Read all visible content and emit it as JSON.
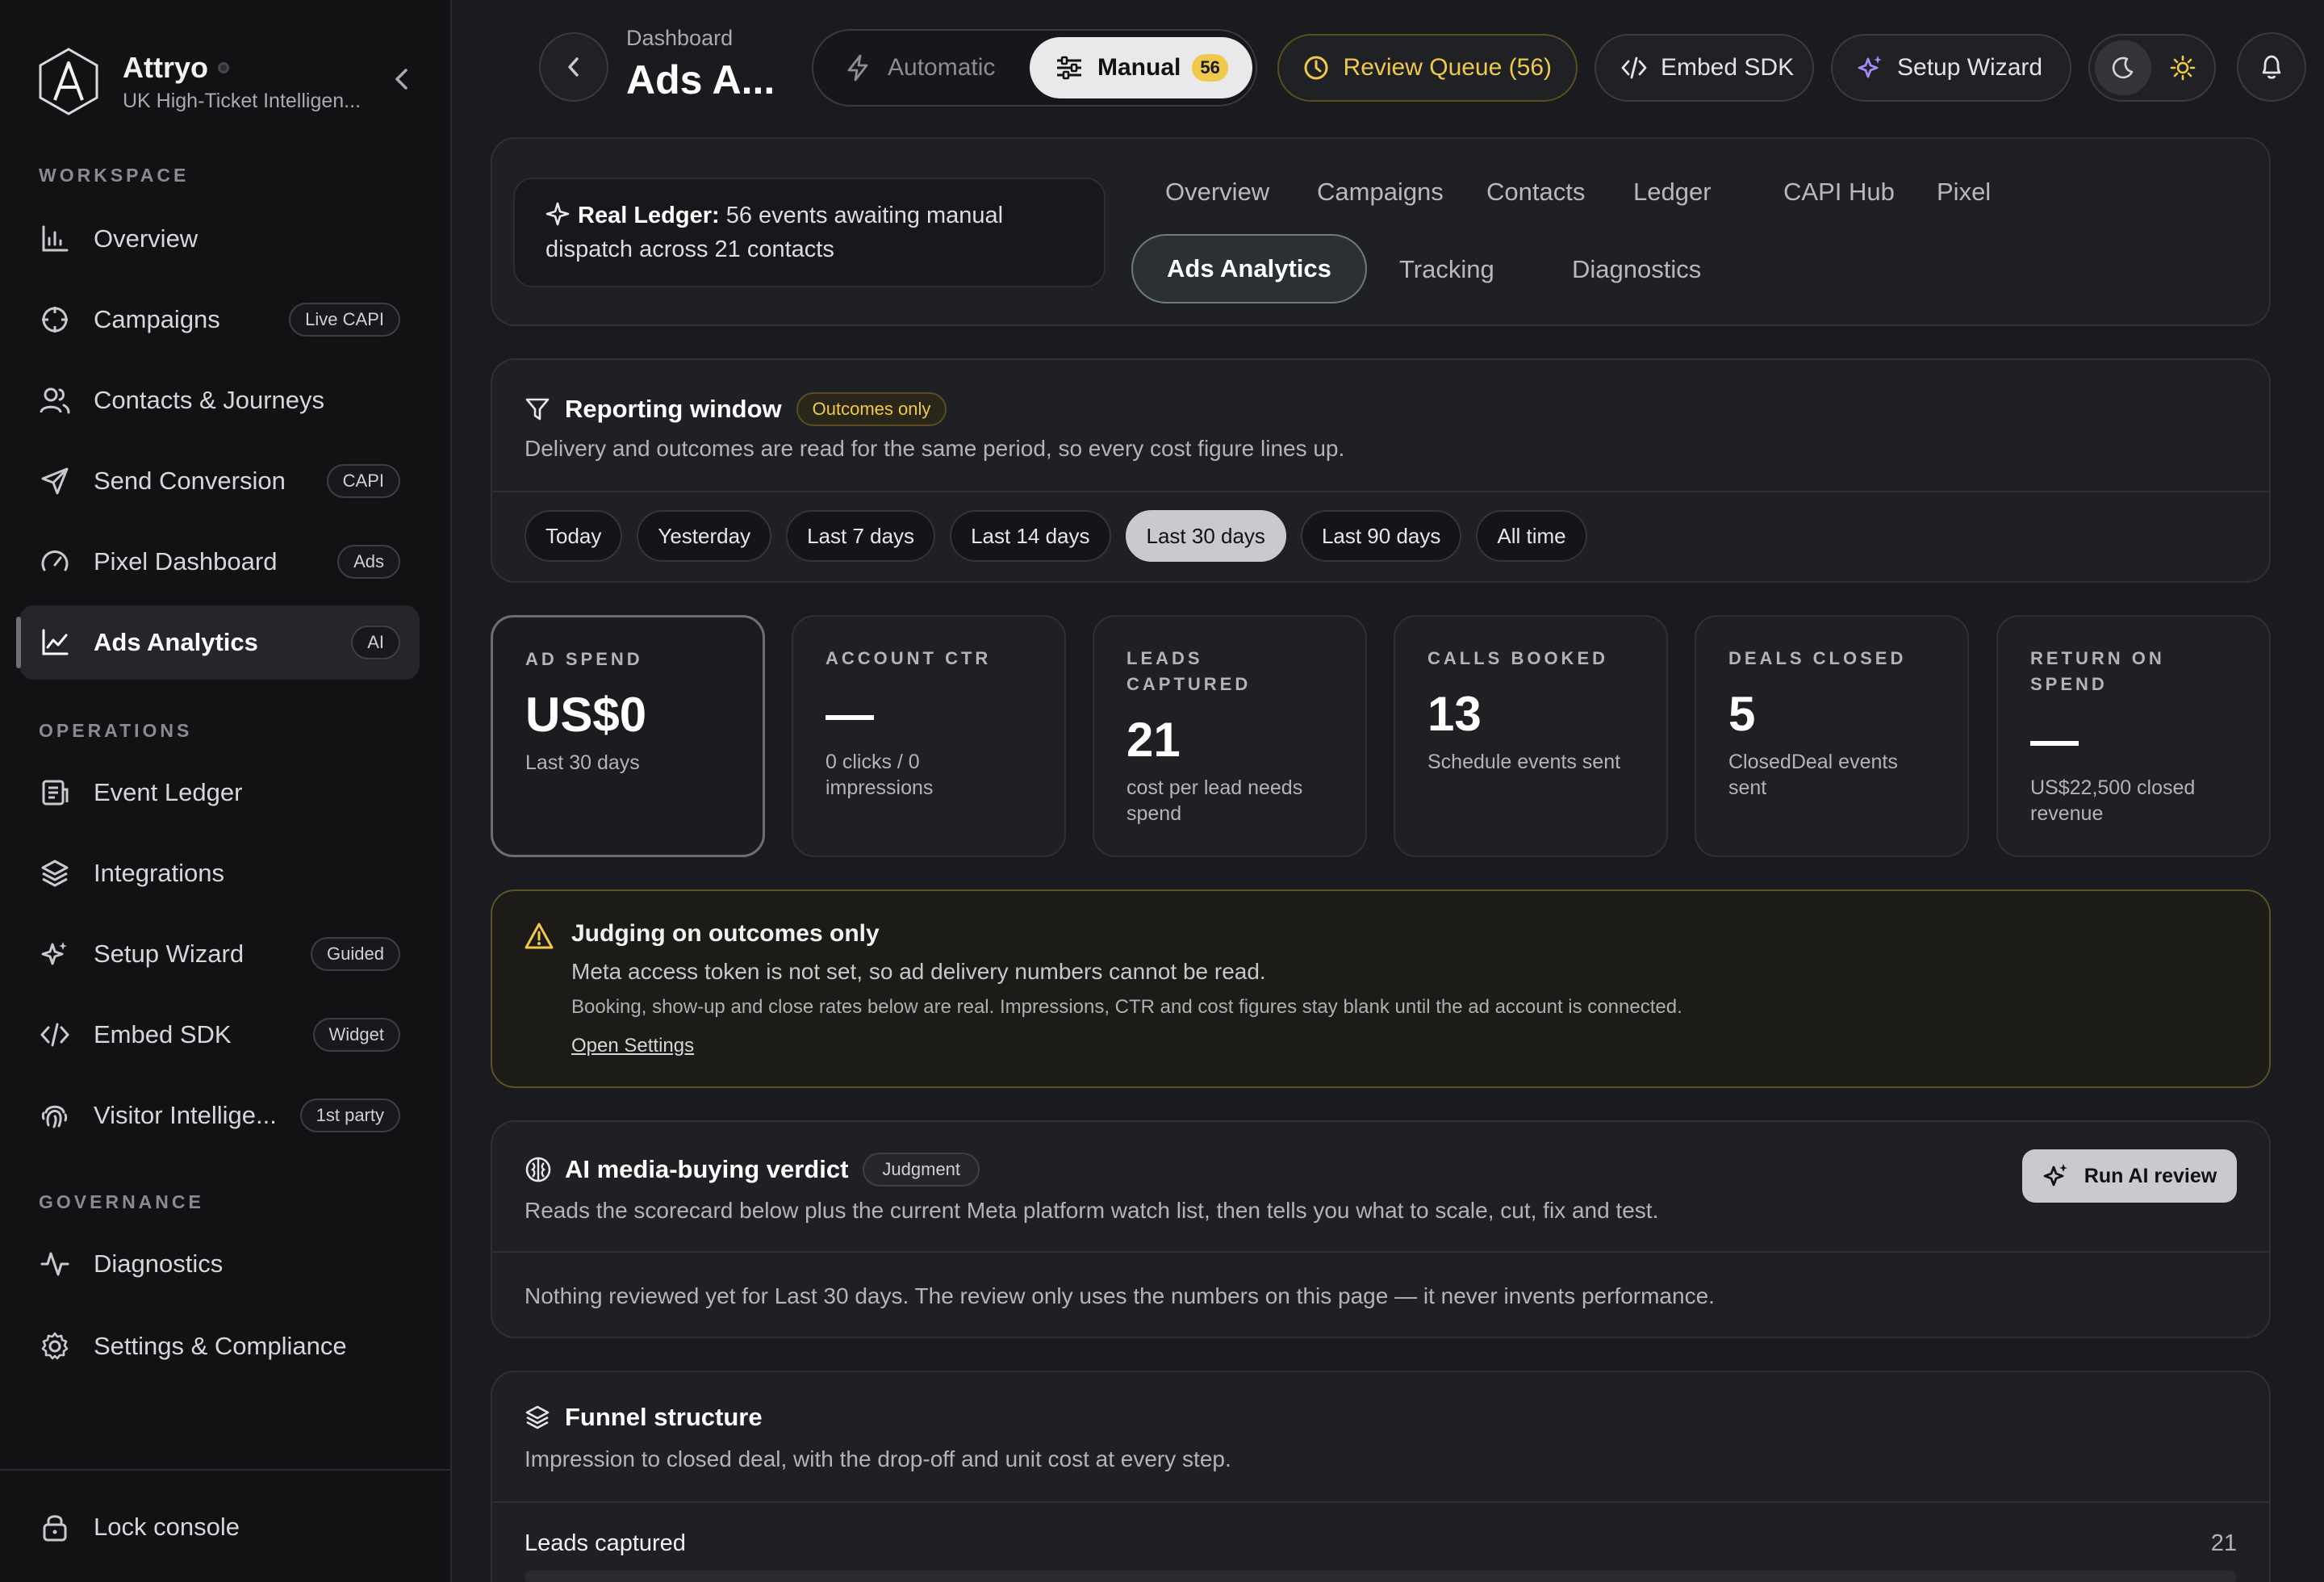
{
  "brand": {
    "name": "Attryo",
    "subtitle": "UK High-Ticket Intelligen..."
  },
  "sidebar": {
    "sections": {
      "workspace": "WORKSPACE",
      "operations": "OPERATIONS",
      "governance": "GOVERNANCE"
    },
    "items": [
      {
        "label": "Overview",
        "badge": ""
      },
      {
        "label": "Campaigns",
        "badge": "Live CAPI"
      },
      {
        "label": "Contacts & Journeys",
        "badge": ""
      },
      {
        "label": "Send Conversion",
        "badge": "CAPI"
      },
      {
        "label": "Pixel Dashboard",
        "badge": "Ads"
      },
      {
        "label": "Ads Analytics",
        "badge": "AI"
      },
      {
        "label": "Event Ledger",
        "badge": ""
      },
      {
        "label": "Integrations",
        "badge": ""
      },
      {
        "label": "Setup Wizard",
        "badge": "Guided"
      },
      {
        "label": "Embed SDK",
        "badge": "Widget"
      },
      {
        "label": "Visitor Intellige...",
        "badge": "1st party"
      },
      {
        "label": "Diagnostics",
        "badge": ""
      },
      {
        "label": "Settings & Compliance",
        "badge": ""
      }
    ],
    "footer": {
      "lock_label": "Lock console"
    }
  },
  "header": {
    "breadcrumb": "Dashboard",
    "title": "Ads A...",
    "mode": {
      "automatic": "Automatic",
      "manual": "Manual",
      "manual_count": "56"
    },
    "review_queue": "Review Queue (56)",
    "embed_sdk": "Embed SDK",
    "setup_wizard": "Setup Wizard"
  },
  "ledger": {
    "label": "Real Ledger:",
    "message": "56 events awaiting manual dispatch across 21 contacts"
  },
  "tabs": [
    "Overview",
    "Campaigns",
    "Contacts",
    "Ledger",
    "CAPI Hub",
    "Pixel",
    "Ads Analytics",
    "Tracking",
    "Diagnostics"
  ],
  "active_tab": "Ads Analytics",
  "reporting": {
    "title": "Reporting window",
    "tag": "Outcomes only",
    "subtitle": "Delivery and outcomes are read for the same period, so every cost figure lines up.",
    "ranges": [
      "Today",
      "Yesterday",
      "Last 7 days",
      "Last 14 days",
      "Last 30 days",
      "Last 90 days",
      "All time"
    ],
    "selected": "Last 30 days"
  },
  "kpis": [
    {
      "label": "AD SPEND",
      "value": "US$0",
      "sub": "Last 30 days"
    },
    {
      "label": "ACCOUNT CTR",
      "value": "—",
      "sub": "0 clicks / 0 impressions"
    },
    {
      "label": "LEADS CAPTURED",
      "value": "21",
      "sub": "cost per lead needs spend"
    },
    {
      "label": "CALLS BOOKED",
      "value": "13",
      "sub": "Schedule events sent"
    },
    {
      "label": "DEALS CLOSED",
      "value": "5",
      "sub": "ClosedDeal events sent"
    },
    {
      "label": "RETURN ON SPEND",
      "value": "—",
      "sub": "US$22,500 closed revenue"
    }
  ],
  "warning": {
    "title": "Judging on outcomes only",
    "line1": "Meta access token is not set, so ad delivery numbers cannot be read.",
    "line2": "Booking, show-up and close rates below are real. Impressions, CTR and cost figures stay blank until the ad account is connected.",
    "link": "Open Settings"
  },
  "verdict": {
    "title": "AI media-buying verdict",
    "tag": "Judgment",
    "subtitle": "Reads the scorecard below plus the current Meta platform watch list, then tells you what to scale, cut, fix and test.",
    "button": "Run AI review",
    "empty": "Nothing reviewed yet for Last 30 days. The review only uses the numbers on this page — it never invents performance."
  },
  "funnel": {
    "title": "Funnel structure",
    "subtitle": "Impression to closed deal, with the drop-off and unit cost at every step.",
    "rows": [
      {
        "label": "Leads captured",
        "value": "21"
      }
    ]
  },
  "colors": {
    "accent_gold": "#f0c94a",
    "background": "#1a1b1f",
    "sidebar": "#111214"
  }
}
